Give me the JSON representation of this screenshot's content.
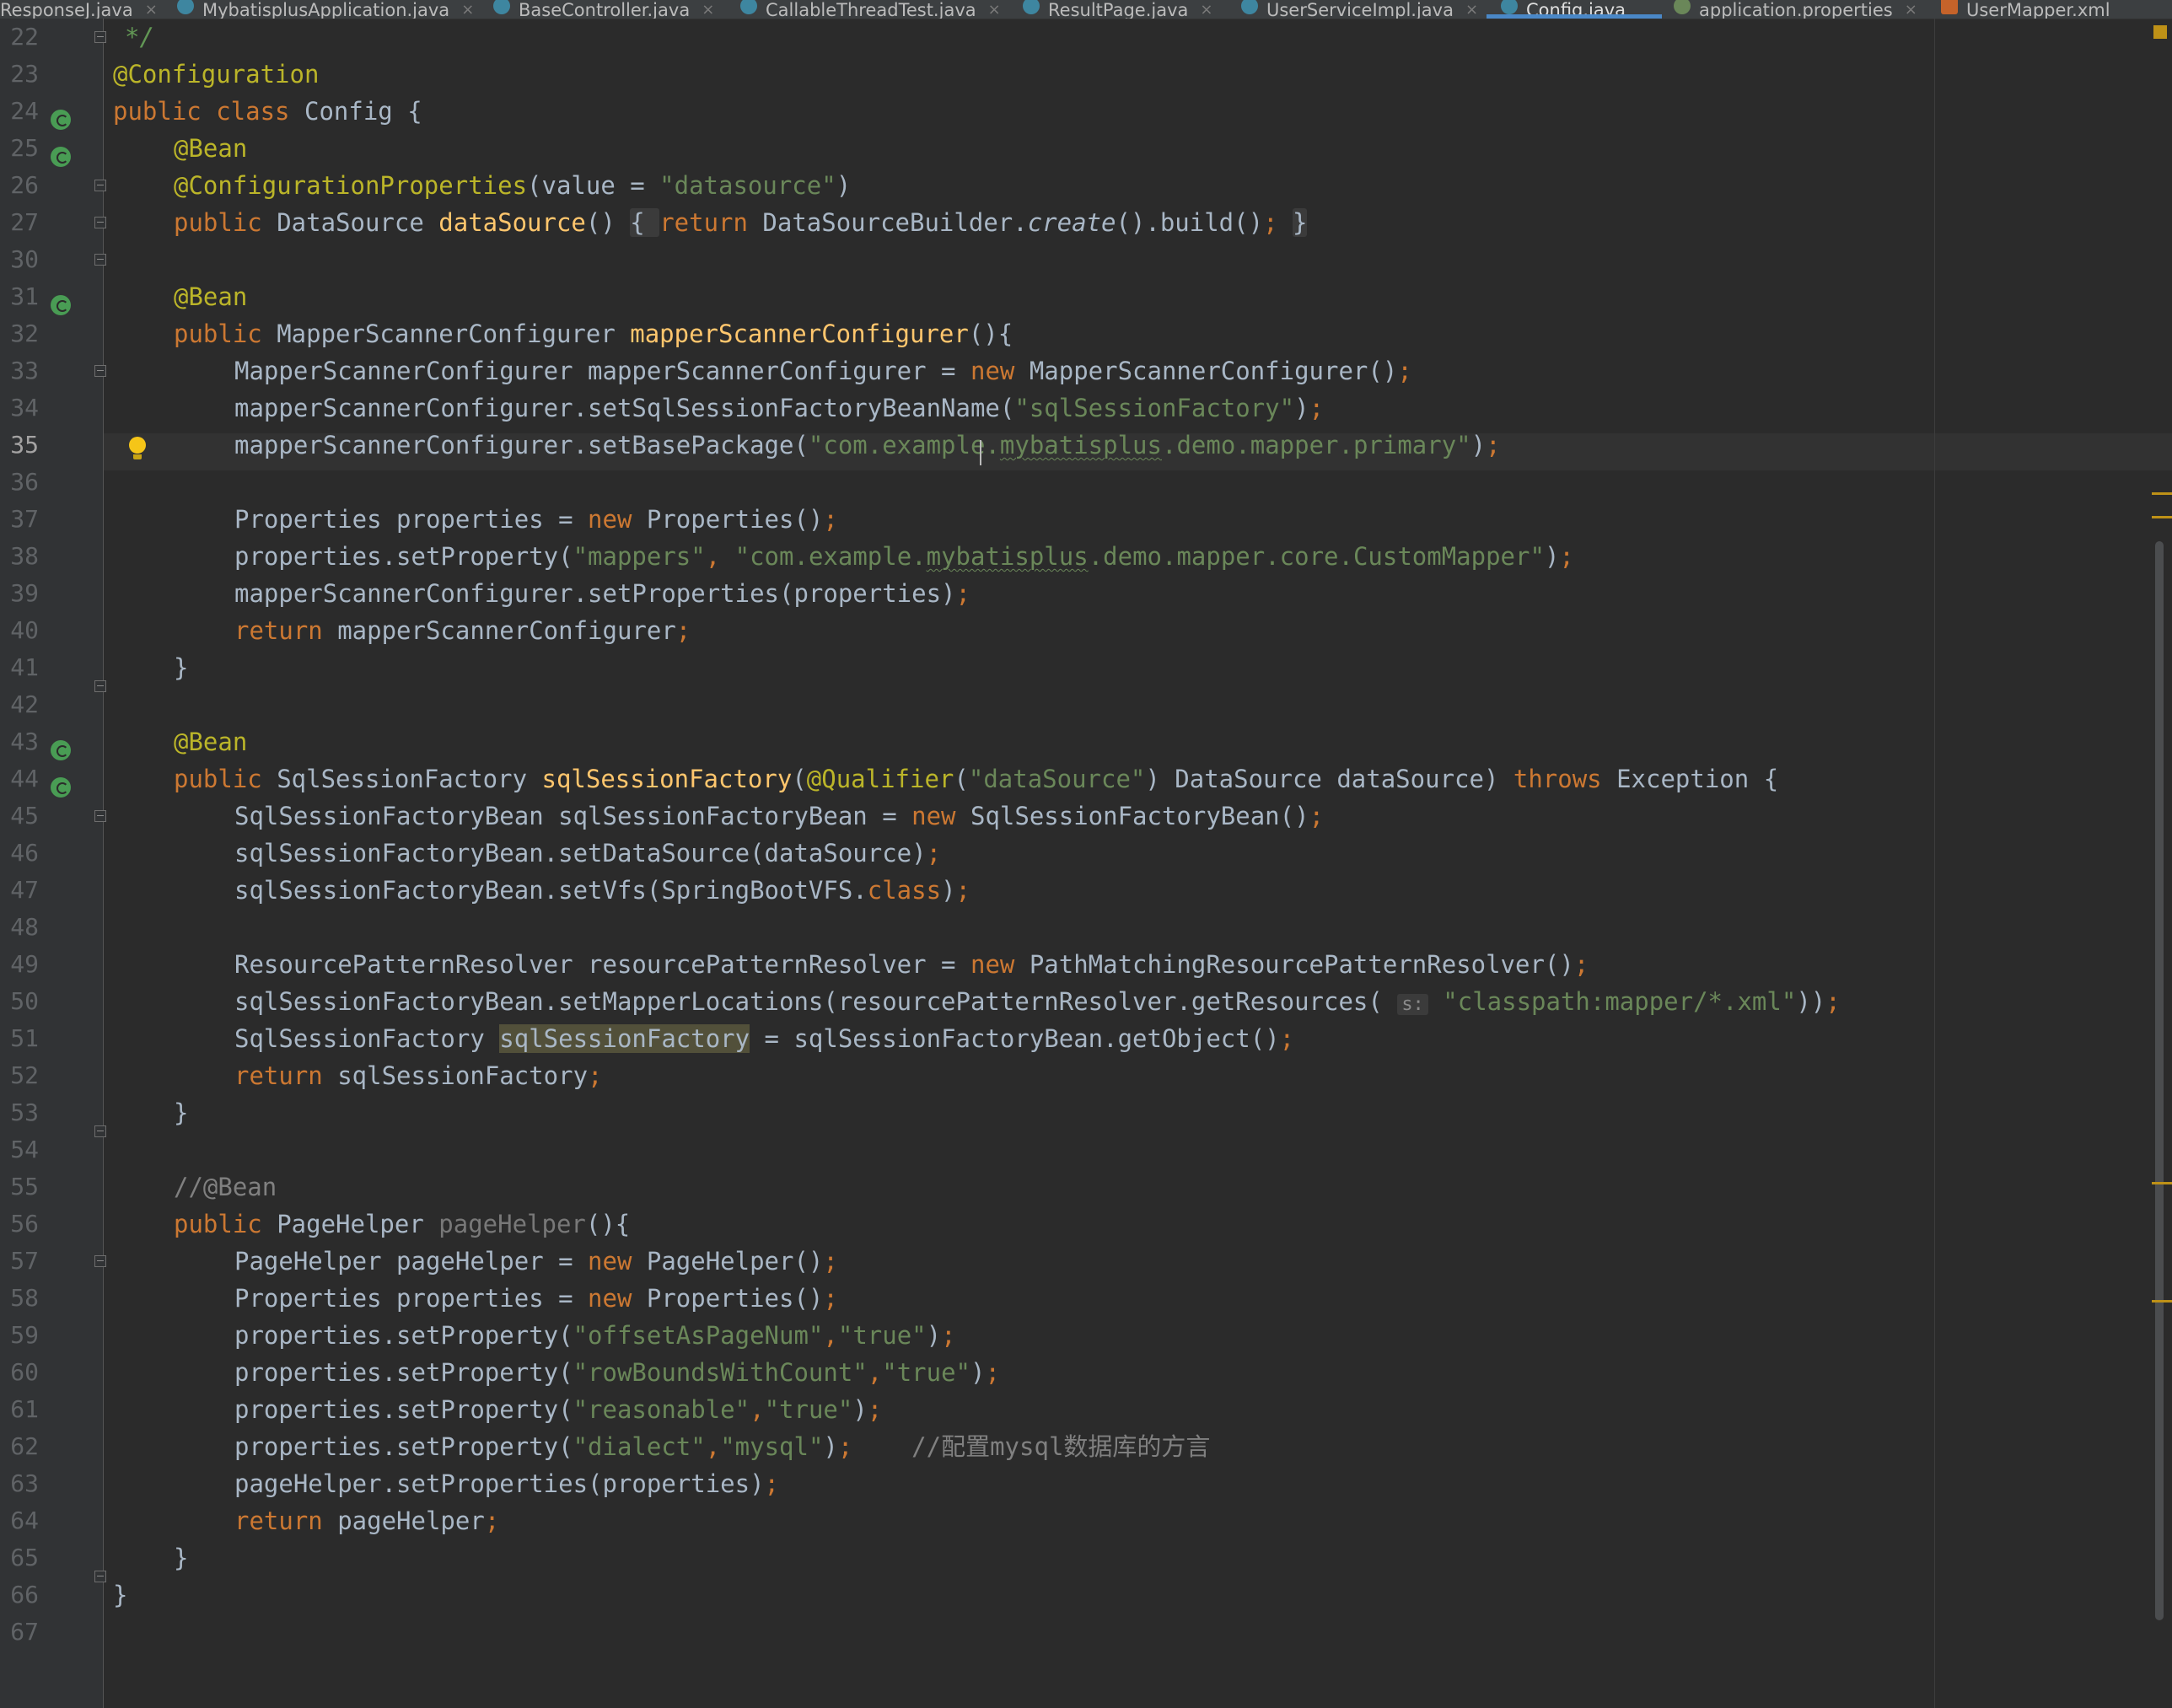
{
  "tabs": [
    {
      "label": "ResponseJ.java",
      "icon": "class-icon"
    },
    {
      "label": "MybatisplusApplication.java",
      "icon": "spring-class-icon"
    },
    {
      "label": "BaseController.java",
      "icon": "class-icon"
    },
    {
      "label": "CallableThreadTest.java",
      "icon": "class-icon"
    },
    {
      "label": "ResultPage.java",
      "icon": "class-icon"
    },
    {
      "label": "UserServiceImpl.java",
      "icon": "class-icon"
    },
    {
      "label": "Config.java",
      "icon": "class-icon",
      "active": true
    },
    {
      "label": "application.properties",
      "icon": "properties-icon"
    },
    {
      "label": "UserMapper.xml",
      "icon": "xml-icon"
    }
  ],
  "editor": {
    "current_line": "35",
    "lines": [
      {
        "n": "22"
      },
      {
        "n": "23"
      },
      {
        "n": "24"
      },
      {
        "n": "25"
      },
      {
        "n": "26"
      },
      {
        "n": "27"
      },
      {
        "n": "30"
      },
      {
        "n": "31"
      },
      {
        "n": "32"
      },
      {
        "n": "33"
      },
      {
        "n": "34"
      },
      {
        "n": "35"
      },
      {
        "n": "36"
      },
      {
        "n": "37"
      },
      {
        "n": "38"
      },
      {
        "n": "39"
      },
      {
        "n": "40"
      },
      {
        "n": "41"
      },
      {
        "n": "42"
      },
      {
        "n": "43"
      },
      {
        "n": "44"
      },
      {
        "n": "45"
      },
      {
        "n": "46"
      },
      {
        "n": "47"
      },
      {
        "n": "48"
      },
      {
        "n": "49"
      },
      {
        "n": "50"
      },
      {
        "n": "51"
      },
      {
        "n": "52"
      },
      {
        "n": "53"
      },
      {
        "n": "54"
      },
      {
        "n": "55"
      },
      {
        "n": "56"
      },
      {
        "n": "57"
      },
      {
        "n": "58"
      },
      {
        "n": "59"
      },
      {
        "n": "60"
      },
      {
        "n": "61"
      },
      {
        "n": "62"
      },
      {
        "n": "63"
      },
      {
        "n": "64"
      },
      {
        "n": "65"
      },
      {
        "n": "66"
      },
      {
        "n": "67"
      }
    ]
  },
  "code": {
    "l22": "*/",
    "l23": "@Configuration",
    "l24": [
      "public class ",
      "Config {"
    ],
    "l25": "@Bean",
    "l26": [
      "@ConfigurationProperties",
      "(value = ",
      "\"datasource\"",
      ")"
    ],
    "l27": [
      "public ",
      "DataSource ",
      "dataSource",
      "() ",
      "{ ",
      "return ",
      "DataSourceBuilder.",
      "create",
      "().build()",
      "; ",
      "}"
    ],
    "l31": "@Bean",
    "l32": [
      "public ",
      "MapperScannerConfigurer ",
      "mapperScannerConfigurer",
      "(){"
    ],
    "l33": [
      "MapperScannerConfigurer mapperScannerConfigurer = ",
      "new ",
      "MapperScannerConfigurer()",
      ";"
    ],
    "l34": [
      "mapperScannerConfigurer.setSqlSessionFactoryBeanName(",
      "\"sqlSessionFactory\"",
      ")",
      ";"
    ],
    "l35": [
      "mapperScannerConfigurer.setBasePackage(",
      "\"com.examp",
      "le.",
      "mybatisplus",
      ".demo.mapper.primary\"",
      ")",
      ";"
    ],
    "l37": [
      "Properties properties = ",
      "new ",
      "Properties()",
      ";"
    ],
    "l38": [
      "properties.setProperty(",
      "\"mappers\"",
      ", ",
      "\"com.example.",
      "mybatisplus",
      ".demo.mapper.core.CustomMapper\"",
      ")",
      ";"
    ],
    "l39": [
      "mapperScannerConfigurer.setProperties(properties)",
      ";"
    ],
    "l40": [
      "return ",
      "mapperScannerConfigurer",
      ";"
    ],
    "l41": "}",
    "l43": "@Bean",
    "l44": [
      "public ",
      "SqlSessionFactory ",
      "sqlSessionFactory",
      "(",
      "@Qualifier",
      "(",
      "\"dataSource\"",
      ") DataSource dataSource) ",
      "throws ",
      "Exception {"
    ],
    "l45": [
      "SqlSessionFactoryBean sqlSessionFactoryBean = ",
      "new ",
      "SqlSessionFactoryBean()",
      ";"
    ],
    "l46": [
      "sqlSessionFactoryBean.setDataSource(dataSource)",
      ";"
    ],
    "l47": [
      "sqlSessionFactoryBean.setVfs(SpringBootVFS.",
      "class",
      ")",
      ";"
    ],
    "l49": [
      "ResourcePatternResolver resourcePatternResolver = ",
      "new ",
      "PathMatchingResourcePatternResolver()",
      ";"
    ],
    "l50": [
      "sqlSessionFactoryBean.setMapperLocations(resourcePatternResolver.getResources( ",
      "s:",
      " ",
      "\"classpath:mapper/*.xml\"",
      "))",
      ";"
    ],
    "l51": [
      "SqlSessionFactory ",
      "sqlSessionFactory",
      " = sqlSessionFactoryBean.getObject()",
      ";"
    ],
    "l52": [
      "return ",
      "sqlSessionFactory",
      ";"
    ],
    "l53": "}",
    "l55": "//@Bean",
    "l56": [
      "public ",
      "PageHelper ",
      "pageHelper",
      "(){"
    ],
    "l57": [
      "PageHelper pageHelper = ",
      "new ",
      "PageHelper()",
      ";"
    ],
    "l58": [
      "Properties properties = ",
      "new ",
      "Properties()",
      ";"
    ],
    "l59": [
      "properties.setProperty(",
      "\"offsetAsPageNum\"",
      ",",
      "\"true\"",
      ")",
      ";"
    ],
    "l60": [
      "properties.setProperty(",
      "\"rowBoundsWithCount\"",
      ",",
      "\"true\"",
      ")",
      ";"
    ],
    "l61": [
      "properties.setProperty(",
      "\"reasonable\"",
      ",",
      "\"true\"",
      ")",
      ";"
    ],
    "l62": [
      "properties.setProperty(",
      "\"dialect\"",
      ",",
      "\"mysql\"",
      ")",
      ";",
      "    //配置mysql数据库的方言"
    ],
    "l63": [
      "pageHelper.setProperties(properties)",
      ";"
    ],
    "l64": [
      "return ",
      "pageHelper",
      ";"
    ],
    "l65": "}",
    "l66": "}"
  },
  "colors": {
    "background": "#2b2b2b",
    "keyword": "#cc7832",
    "annotation": "#bbb529",
    "string": "#6a8759",
    "method": "#ffc66d",
    "default_text": "#a9b7c6",
    "comment": "#808080"
  }
}
